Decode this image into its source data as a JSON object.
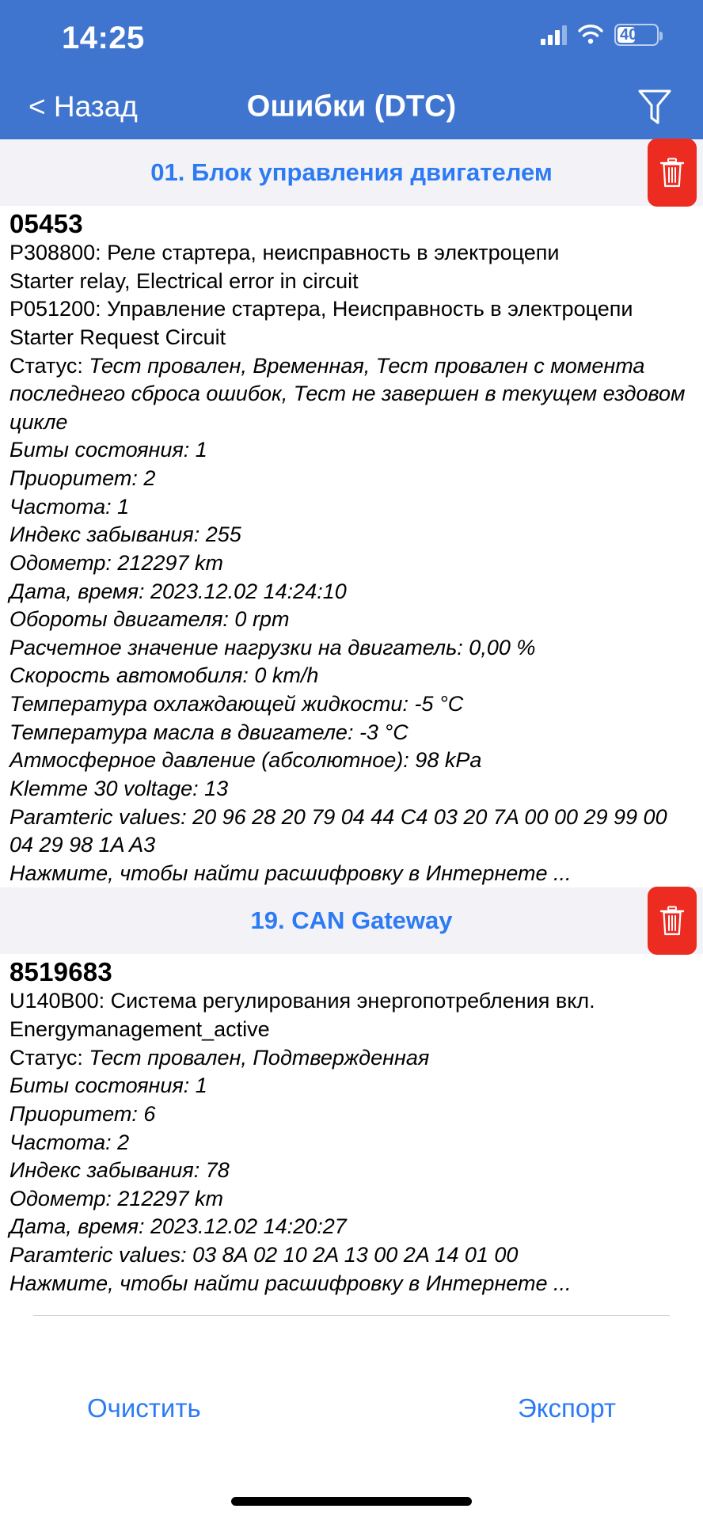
{
  "status_bar": {
    "time": "14:25",
    "cellular_icon": "cellular-signal-icon",
    "wifi_icon": "wifi-icon",
    "battery_icon": "battery-icon",
    "battery_level": "40"
  },
  "nav": {
    "back_label": "< Назад",
    "title": "Ошибки (DTC)",
    "filter_icon": "filter-funnel-icon"
  },
  "colors": {
    "nav_background": "#3f75cf",
    "accent_blue": "#2d7bf4",
    "delete_red": "#ec2b21",
    "section_background": "#f2f2f7"
  },
  "sections": [
    {
      "title": "01. Блок управления двигателем",
      "delete_icon": "trash-icon",
      "entries": [
        {
          "code": "05453",
          "lines": [
            {
              "text": "P308800: Реле стартера, неисправность в электроцепи",
              "style": "normal"
            },
            {
              "text": "Starter relay, Electrical error in circuit",
              "style": "normal"
            },
            {
              "text": "P051200: Управление стартера, Неисправность в электроцепи",
              "style": "normal"
            },
            {
              "text": "Starter Request Circuit",
              "style": "normal"
            },
            {
              "label": "Статус: ",
              "value": "Тест провален, Временная, Тест провален с момента последнего сброса ошибок, Тест не завершен в текущем ездовом цикле",
              "style": "mixed"
            },
            {
              "text": "Биты состояния: 1",
              "style": "italic"
            },
            {
              "text": "Приоритет: 2",
              "style": "italic"
            },
            {
              "text": "Частота: 1",
              "style": "italic"
            },
            {
              "text": "Индекс забывания: 255",
              "style": "italic"
            },
            {
              "text": "Одометр: 212297 km",
              "style": "italic"
            },
            {
              "text": "Дата, время: 2023.12.02 14:24:10",
              "style": "italic"
            },
            {
              "text": "Обороты двигателя: 0 rpm",
              "style": "italic"
            },
            {
              "text": "Расчетное значение нагрузки на двигатель: 0,00 %",
              "style": "italic"
            },
            {
              "text": "Скорость автомобиля: 0 km/h",
              "style": "italic"
            },
            {
              "text": "Температура охлаждающей жидкости: -5 °C",
              "style": "italic"
            },
            {
              "text": "Температура масла в двигателе: -3 °C",
              "style": "italic"
            },
            {
              "text": "Атмосферное давление (абсолютное): 98 kPa",
              "style": "italic"
            },
            {
              "text": "Klemme 30 voltage: 13",
              "style": "italic"
            },
            {
              "text": "Paramteric values:  20 96 28 20 79 04 44 C4 03 20 7A 00 00 29 99 00 04 29 98 1A A3",
              "style": "italic"
            },
            {
              "text": "Нажмите, чтобы найти расшифровку в Интернете ...",
              "style": "italic"
            }
          ]
        }
      ]
    },
    {
      "title": "19. CAN Gateway",
      "delete_icon": "trash-icon",
      "entries": [
        {
          "code": "8519683",
          "lines": [
            {
              "text": "U140B00: Система регулирования энергопотребления вкл.",
              "style": "normal"
            },
            {
              "text": "Energymanagement_active",
              "style": "normal"
            },
            {
              "label": "Статус: ",
              "value": "Тест провален, Подтвержденная",
              "style": "mixed"
            },
            {
              "text": "Биты состояния: 1",
              "style": "italic"
            },
            {
              "text": "Приоритет: 6",
              "style": "italic"
            },
            {
              "text": "Частота: 2",
              "style": "italic"
            },
            {
              "text": "Индекс забывания: 78",
              "style": "italic"
            },
            {
              "text": "Одометр: 212297 km",
              "style": "italic"
            },
            {
              "text": "Дата, время: 2023.12.02 14:20:27",
              "style": "italic"
            },
            {
              "text": "Paramteric values:  03 8A 02 10 2A 13 00 2A 14 01 00",
              "style": "italic"
            },
            {
              "text": "Нажмите, чтобы найти расшифровку в Интернете ...",
              "style": "italic"
            }
          ]
        }
      ]
    }
  ],
  "footer": {
    "clear_label": "Очистить",
    "export_label": "Экспорт"
  }
}
